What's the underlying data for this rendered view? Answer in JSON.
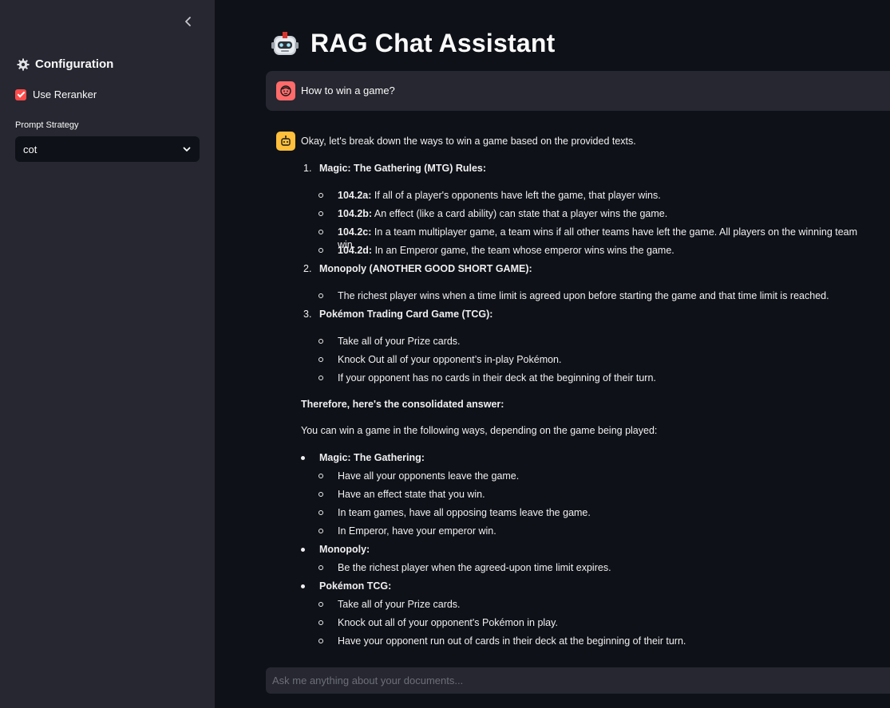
{
  "sidebar": {
    "title": "Configuration",
    "use_reranker_label": "Use Reranker",
    "use_reranker_checked": true,
    "prompt_strategy_label": "Prompt Strategy",
    "prompt_strategy_value": "cot"
  },
  "main": {
    "title": "RAG Chat Assistant",
    "user_message": "How to win a game?",
    "answer": {
      "intro": "Okay, let's break down the ways to win a game based on the provided texts.",
      "sections": [
        {
          "num": "1.",
          "heading": "Magic: The Gathering (MTG) Rules:",
          "items": [
            {
              "bold": "104.2a:",
              "text": " If all of a player's opponents have left the game, that player wins."
            },
            {
              "bold": "104.2b:",
              "text": " An effect (like a card ability) can state that a player wins the game."
            },
            {
              "bold": "104.2c:",
              "text": " In a team multiplayer game, a team wins if all other teams have left the game. All players on the winning team win."
            },
            {
              "bold": "104.2d:",
              "text": " In an Emperor game, the team whose emperor wins wins the game."
            }
          ]
        },
        {
          "num": "2.",
          "heading": "Monopoly (ANOTHER GOOD SHORT GAME):",
          "items": [
            {
              "bold": "",
              "text": "The richest player wins when a time limit is agreed upon before starting the game and that time limit is reached."
            }
          ]
        },
        {
          "num": "3.",
          "heading": "Pokémon Trading Card Game (TCG):",
          "items": [
            {
              "bold": "",
              "text": "Take all of your Prize cards."
            },
            {
              "bold": "",
              "text": "Knock Out all of your opponent’s in-play Pokémon."
            },
            {
              "bold": "",
              "text": "If your opponent has no cards in their deck at the beginning of their turn."
            }
          ]
        }
      ],
      "therefore": "Therefore, here's the consolidated answer:",
      "summary_intro": "You can win a game in the following ways, depending on the game being played:",
      "summary": [
        {
          "heading": "Magic: The Gathering:",
          "items": [
            "Have all your opponents leave the game.",
            "Have an effect state that you win.",
            "In team games, have all opposing teams leave the game.",
            "In Emperor, have your emperor win."
          ]
        },
        {
          "heading": "Monopoly:",
          "items": [
            "Be the richest player when the agreed-upon time limit expires."
          ]
        },
        {
          "heading": "Pokémon TCG:",
          "items": [
            "Take all of your Prize cards.",
            "Knock out all of your opponent's Pokémon in play.",
            "Have your opponent run out of cards in their deck at the beginning of their turn."
          ]
        }
      ]
    },
    "chat_input_placeholder": "Ask me anything about your documents..."
  },
  "colors": {
    "accent": "#ff4b4b",
    "sidebar_bg": "#262730",
    "main_bg": "#0e1117",
    "user_avatar": "#ff6b6b",
    "assistant_avatar": "#fdbf3c"
  },
  "icons": [
    "chevron-left-icon",
    "gear-icon",
    "chevron-down-icon",
    "robot-icon",
    "user-face-icon",
    "bot-icon"
  ]
}
